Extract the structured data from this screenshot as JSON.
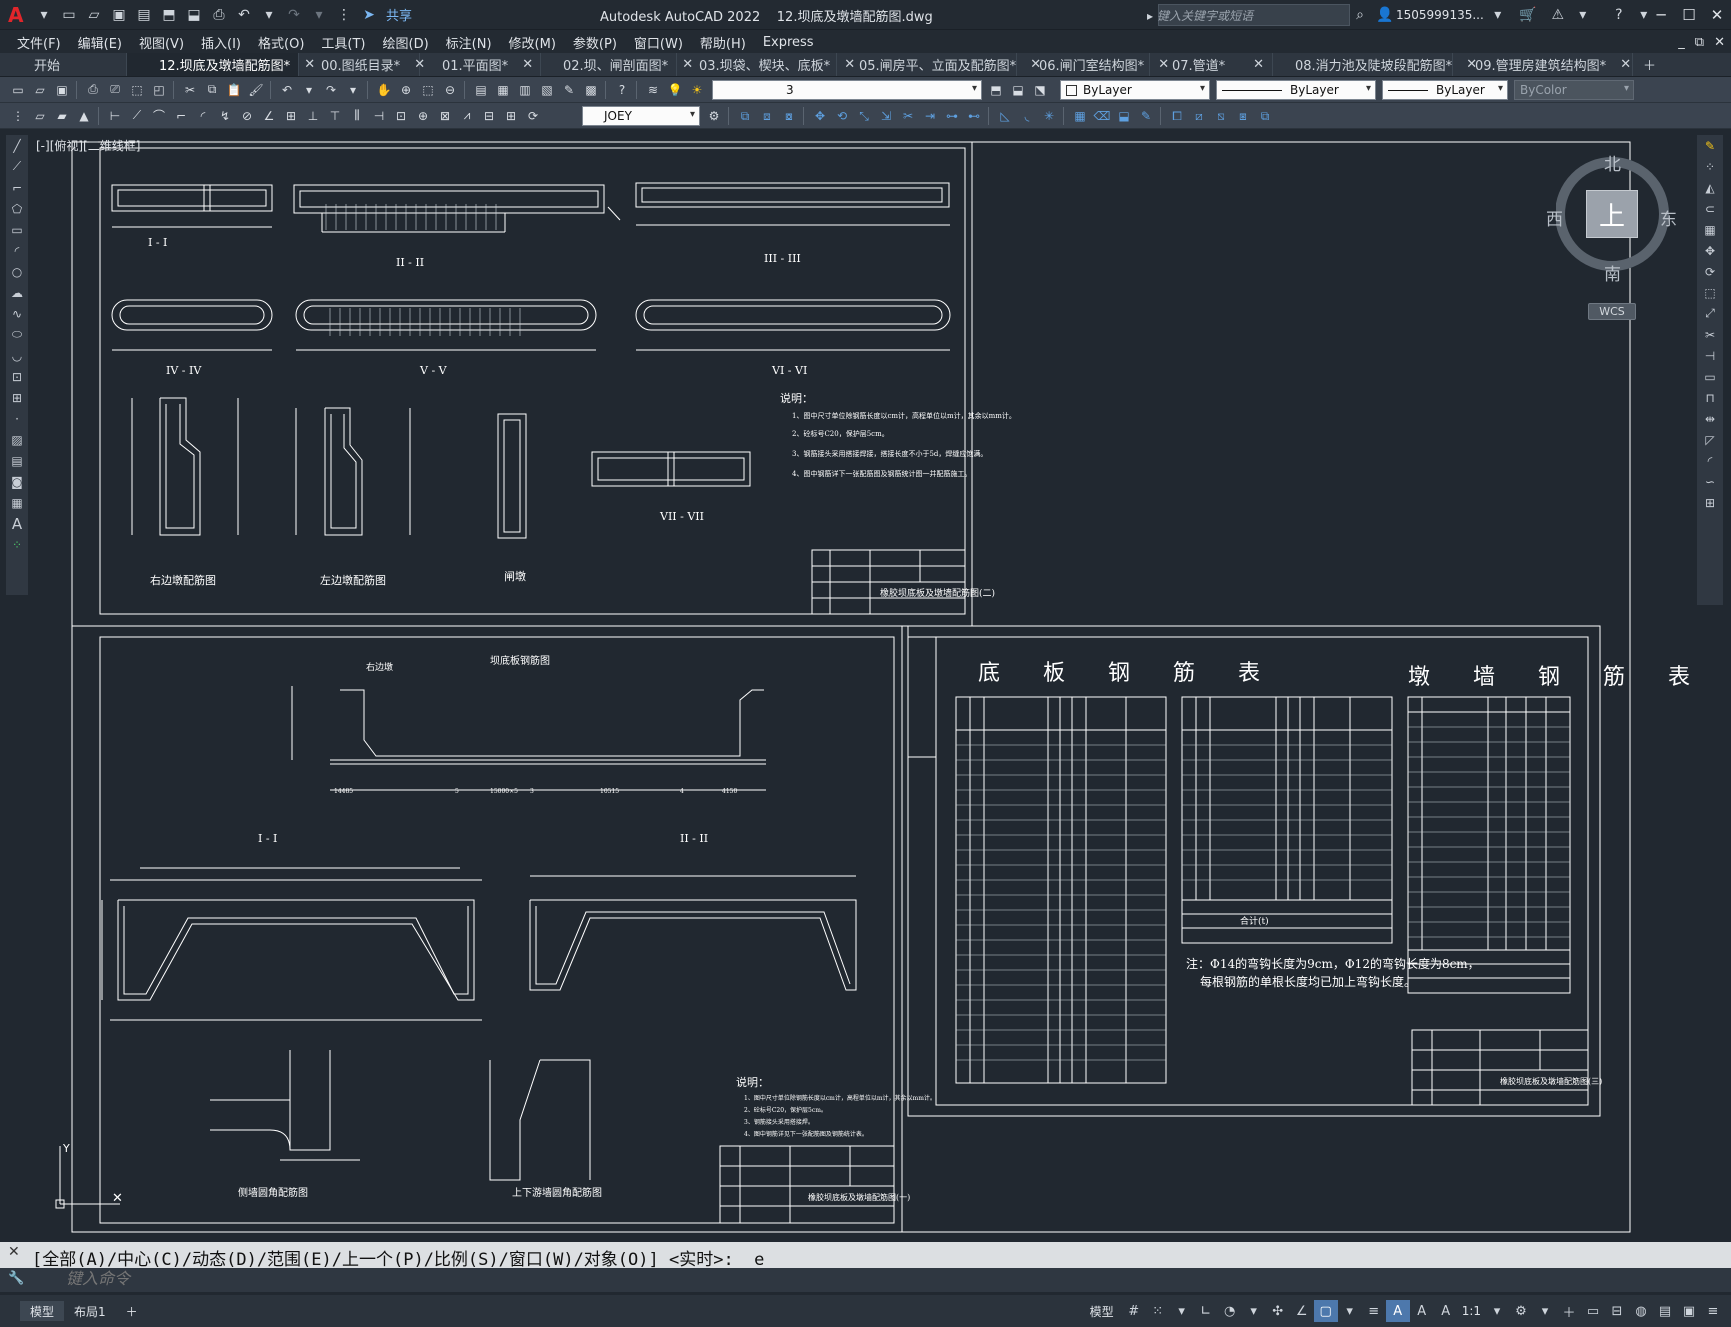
{
  "app": {
    "title": "Autodesk AutoCAD 2022",
    "filename": "12.坝底及墩墙配筋图.dwg"
  },
  "quick_access": {
    "share_label": "共享"
  },
  "search": {
    "placeholder": "键入关键字或短语"
  },
  "account": {
    "user": "1505999135..."
  },
  "menu": [
    "文件(F)",
    "编辑(E)",
    "视图(V)",
    "插入(I)",
    "格式(O)",
    "工具(T)",
    "绘图(D)",
    "标注(N)",
    "修改(M)",
    "参数(P)",
    "窗口(W)",
    "帮助(H)",
    "Express"
  ],
  "tabs": [
    {
      "label": "开始",
      "active": false
    },
    {
      "label": "12.坝底及墩墙配筋图*",
      "active": true
    },
    {
      "label": "00.图纸目录*",
      "active": false
    },
    {
      "label": "01.平面图*",
      "active": false
    },
    {
      "label": "02.坝、闸剖面图*",
      "active": false
    },
    {
      "label": "03.坝袋、楔块、底板*",
      "active": false
    },
    {
      "label": "05.闸房平、立面及配筋图*",
      "active": false
    },
    {
      "label": "06.闸门室结构图*",
      "active": false
    },
    {
      "label": "07.管道*",
      "active": false
    },
    {
      "label": "08.消力池及陡坡段配筋图*",
      "active": false
    },
    {
      "label": "09.管理房建筑结构图*",
      "active": false
    }
  ],
  "toolbar": {
    "layer_value": "3",
    "color_value": "ByLayer",
    "linetype_value": "ByLayer",
    "lineweight_value": "ByLayer",
    "plotstyle_value": "ByColor",
    "dimstyle_value": "JOEY"
  },
  "viewport": {
    "label": "[-][俯视][二维线框]"
  },
  "viewcube": {
    "top": "上",
    "north": "北",
    "south": "南",
    "east": "东",
    "west": "西",
    "wcs": "WCS"
  },
  "drawing": {
    "sheet1": {
      "sections": [
        "I - I",
        "II - II",
        "III - III",
        "IV - IV",
        "V - V",
        "VI - VI",
        "VII - VII"
      ],
      "details": [
        "右边墩配筋图",
        "左边墩配筋图",
        "闸墩"
      ],
      "notes_title": "说明：",
      "notes": [
        "1、图中尺寸单位除钢筋长度以cm计，高程单位以m计，其余以mm计。",
        "2、砼标号C20，保护层5cm。",
        "3、钢筋接头采用搭接焊接，搭接长度不小于5d，焊缝应饱满。",
        "4、图中钢筋详下一张配筋图及钢筋统计图一并配筋施工。"
      ],
      "title_block": "橡胶坝底板及墩墙配筋图(二)"
    },
    "sheet2": {
      "main_title": "坝底板钢筋图",
      "sections": [
        "I - I",
        "II - II"
      ],
      "left_label": "右边墩",
      "details": [
        "侧墙圆角配筋图",
        "上下游墙圆角配筋图"
      ],
      "dims": [
        "14485",
        "5",
        "15000×5",
        "3",
        "10515",
        "4",
        "4150"
      ],
      "notes_title": "说明：",
      "notes": [
        "1、图中尺寸单位除钢筋长度以cm计，高程单位以m计，其余以mm计。",
        "2、砼标号C20，保护层5cm。",
        "3、钢筋接头采用搭接焊。",
        "4、图中钢筋详见下一张配筋图及钢筋统计表。"
      ],
      "title_block": "橡胶坝底板及墩墙配筋图(一)"
    },
    "sheet3": {
      "table1_title": "底 板 钢 筋 表",
      "table2_title": "墩 墙 钢 筋 表",
      "note": "注：Φ14的弯钩长度为9cm，Φ12的弯钩长度为8cm，",
      "note2": "每根钢筋的单根长度均已加上弯钩长度。",
      "total": "合计(t)",
      "title_block": "橡胶坝底板及墩墙配筋图(三)"
    }
  },
  "command": {
    "history": "[全部(A)/中心(C)/动态(D)/范围(E)/上一个(P)/比例(S)/窗口(W)/对象(O)] <实时>: _e",
    "placeholder": "键入命令"
  },
  "layout_tabs": [
    "模型",
    "布局1"
  ],
  "status": {
    "model_label": "模型",
    "scale": "1:1"
  }
}
